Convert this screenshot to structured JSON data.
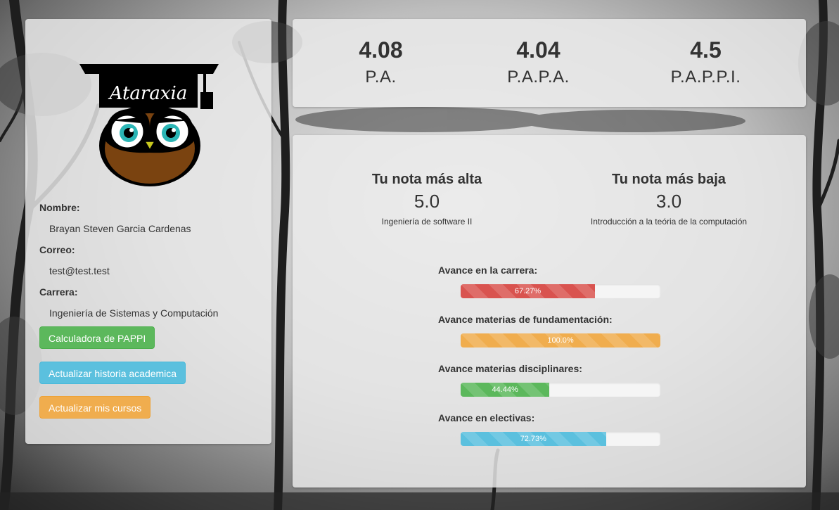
{
  "profile": {
    "logo_text": "Ataraxia",
    "name_label": "Nombre:",
    "name_value": "Brayan Steven Garcia Cardenas",
    "email_label": "Correo:",
    "email_value": "test@test.test",
    "career_label": "Carrera:",
    "career_value": "Ingeniería de Sistemas y Computación"
  },
  "buttons": {
    "pappi_calculator": "Calculadora de PAPPI",
    "update_history": "Actualizar historia academica",
    "update_courses": "Actualizar mis cursos"
  },
  "stats": [
    {
      "value": "4.08",
      "label": "P.A."
    },
    {
      "value": "4.04",
      "label": "P.A.P.A."
    },
    {
      "value": "4.5",
      "label": "P.A.P.P.I."
    }
  ],
  "grades": {
    "highest": {
      "title": "Tu nota más alta",
      "value": "5.0",
      "subject": "Ingeniería de software II"
    },
    "lowest": {
      "title": "Tu nota más baja",
      "value": "3.0",
      "subject": "Introducción a la teória de la computación"
    }
  },
  "progress": [
    {
      "label": "Avance en la carrera:",
      "text": "67.27%",
      "fraction": 0.6727,
      "color": "#d9534f"
    },
    {
      "label": "Avance materias de fundamentación:",
      "text": "100.0%",
      "fraction": 1.0,
      "color": "#f0ad4e"
    },
    {
      "label": "Avance materias disciplinares:",
      "text": "44.44%",
      "fraction": 0.4444,
      "color": "#5cb85c"
    },
    {
      "label": "Avance en electivas:",
      "text": "72.73%",
      "fraction": 0.7273,
      "color": "#5bc0de"
    }
  ]
}
